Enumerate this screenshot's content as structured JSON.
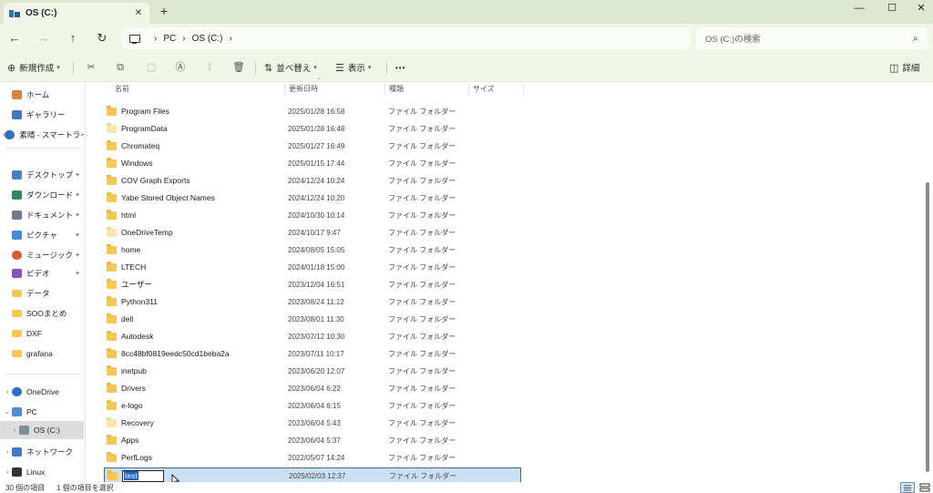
{
  "window": {
    "tab_title": "OS (C:)",
    "tab_close": "✕",
    "new_tab": "+",
    "minimize": "—",
    "maximize": "☐",
    "close": "✕"
  },
  "nav": {
    "back": "←",
    "forward": "→",
    "up": "↑",
    "refresh": "↻",
    "breadcrumbs": [
      "PC",
      "OS (C:)"
    ],
    "crumb_sep": "›",
    "search_placeholder": "OS (C:)の検索",
    "search_icon": "⌕"
  },
  "commands": {
    "new_label": "新規作成",
    "sort_label": "並べ替え",
    "view_label": "表示",
    "more_label": "•••",
    "details_label": "詳細"
  },
  "sidebar": {
    "items": [
      {
        "label": "ホーム",
        "icon": "home-icon",
        "expandable": false,
        "pinned": false
      },
      {
        "label": "ギャラリー",
        "icon": "gallery-icon",
        "expandable": false,
        "pinned": false
      },
      {
        "label": "素晴 - スマートライ",
        "icon": "onedrive-icon",
        "expandable": true,
        "pinned": false
      },
      {
        "label": "デスクトップ",
        "icon": "desktop-icon",
        "expandable": false,
        "pinned": true
      },
      {
        "label": "ダウンロード",
        "icon": "download-icon",
        "expandable": false,
        "pinned": true
      },
      {
        "label": "ドキュメント",
        "icon": "documents-icon",
        "expandable": false,
        "pinned": true
      },
      {
        "label": "ピクチャ",
        "icon": "pictures-icon",
        "expandable": false,
        "pinned": true
      },
      {
        "label": "ミュージック",
        "icon": "music-icon",
        "expandable": false,
        "pinned": true
      },
      {
        "label": "ビデオ",
        "icon": "videos-icon",
        "expandable": false,
        "pinned": true
      },
      {
        "label": "データ",
        "icon": "folder-icon",
        "expandable": false,
        "pinned": false
      },
      {
        "label": "SOOまとめ",
        "icon": "folder-icon",
        "expandable": false,
        "pinned": false
      },
      {
        "label": "DXF",
        "icon": "folder-icon",
        "expandable": false,
        "pinned": false
      },
      {
        "label": "grafana",
        "icon": "folder-icon",
        "expandable": false,
        "pinned": false
      },
      {
        "label": "OneDrive",
        "icon": "onedrive-icon",
        "expandable": true,
        "pinned": false
      },
      {
        "label": "PC",
        "icon": "pc-icon",
        "expandable": true,
        "expanded": true,
        "pinned": false
      },
      {
        "label": "OS (C:)",
        "icon": "drive-icon",
        "expandable": true,
        "pinned": false,
        "selected": true
      },
      {
        "label": "ネットワーク",
        "icon": "network-icon",
        "expandable": true,
        "pinned": false
      },
      {
        "label": "Linux",
        "icon": "linux-icon",
        "expandable": true,
        "pinned": false
      }
    ],
    "pin_glyph": "📌"
  },
  "columns": {
    "name": "名前",
    "date": "更新日時",
    "type": "種類",
    "size": "サイズ"
  },
  "files": [
    {
      "name": "Program Files",
      "date": "2025/01/28 16:58",
      "type": "ファイル フォルダー"
    },
    {
      "name": "ProgramData",
      "date": "2025/01/28 16:48",
      "type": "ファイル フォルダー",
      "hidden": true
    },
    {
      "name": "Chromateq",
      "date": "2025/01/27 16:49",
      "type": "ファイル フォルダー"
    },
    {
      "name": "Windows",
      "date": "2025/01/15 17:44",
      "type": "ファイル フォルダー"
    },
    {
      "name": "COV Graph Exports",
      "date": "2024/12/24 10:24",
      "type": "ファイル フォルダー"
    },
    {
      "name": "Yabe Stored Object Names",
      "date": "2024/12/24 10:20",
      "type": "ファイル フォルダー"
    },
    {
      "name": "html",
      "date": "2024/10/30 10:14",
      "type": "ファイル フォルダー"
    },
    {
      "name": "OneDriveTemp",
      "date": "2024/10/17 9:47",
      "type": "ファイル フォルダー",
      "hidden": true
    },
    {
      "name": "home",
      "date": "2024/08/05 15:05",
      "type": "ファイル フォルダー"
    },
    {
      "name": "LTECH",
      "date": "2024/01/18 15:00",
      "type": "ファイル フォルダー"
    },
    {
      "name": "ユーザー",
      "date": "2023/12/04 16:51",
      "type": "ファイル フォルダー"
    },
    {
      "name": "Python311",
      "date": "2023/08/24 11:12",
      "type": "ファイル フォルダー"
    },
    {
      "name": "dell",
      "date": "2023/08/01 11:30",
      "type": "ファイル フォルダー"
    },
    {
      "name": "Autodesk",
      "date": "2023/07/12 10:30",
      "type": "ファイル フォルダー"
    },
    {
      "name": "8cc48bf0819eedc50cd1beba2a",
      "date": "2023/07/11 10:17",
      "type": "ファイル フォルダー"
    },
    {
      "name": "inetpub",
      "date": "2023/06/20 12:07",
      "type": "ファイル フォルダー"
    },
    {
      "name": "Drivers",
      "date": "2023/06/04 6:22",
      "type": "ファイル フォルダー"
    },
    {
      "name": "e-logo",
      "date": "2023/06/04 6:15",
      "type": "ファイル フォルダー"
    },
    {
      "name": "Recovery",
      "date": "2023/06/04 5:43",
      "type": "ファイル フォルダー",
      "hidden": true
    },
    {
      "name": "Apps",
      "date": "2023/06/04 5:37",
      "type": "ファイル フォルダー"
    },
    {
      "name": "PerfLogs",
      "date": "2022/05/07 14:24",
      "type": "ファイル フォルダー"
    }
  ],
  "renaming": {
    "name": "test",
    "date": "2025/02/03 12:37",
    "type": "ファイル フォルダー"
  },
  "status": {
    "item_count": "30 個の項目",
    "selection": "1 個の項目を選択"
  },
  "colors": {
    "chrome_bg": "#f0f6e8",
    "tab_strip_bg": "#dde7cf",
    "selection_bg": "#cce0f4",
    "selection_border": "#3a6aa8",
    "rename_highlight": "#1a63c4",
    "folder": "#f7c84a"
  }
}
